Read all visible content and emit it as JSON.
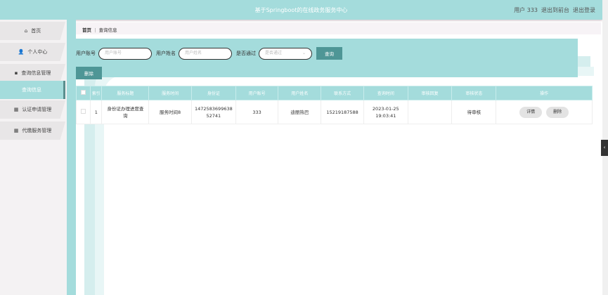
{
  "header": {
    "title": "基于Springboot的在线政务服务中心",
    "user": "用户 333",
    "front": "退出到前台",
    "logout": "退出登录"
  },
  "sidebar": {
    "items": [
      {
        "label": "首页"
      },
      {
        "label": "个人中心"
      },
      {
        "label": "查询信息管理"
      },
      {
        "label": "查询信息"
      },
      {
        "label": "认证申请管理"
      },
      {
        "label": "代缴服务管理"
      }
    ]
  },
  "breadcrumb": {
    "home": "首页",
    "sep": "⋮",
    "current": "查询信息"
  },
  "search": {
    "account_label": "用户账号",
    "account_placeholder": "用户账号",
    "name_label": "用户姓名",
    "name_placeholder": "用户姓名",
    "pass_label": "是否通过",
    "pass_placeholder": "是否通过",
    "query": "查询",
    "delete": "删除"
  },
  "table": {
    "headers": [
      "索引",
      "服务标题",
      "服务时间",
      "身份证",
      "用户账号",
      "用户姓名",
      "联系方式",
      "查询时间",
      "审核回复",
      "审核状态",
      "操作"
    ],
    "rows": [
      {
        "index": "1",
        "title": "身份证办理进度查询",
        "time": "服务时间8",
        "id": "147258369963852741",
        "account": "333",
        "name": "迪丽热巴",
        "phone": "15219187588",
        "query_time": "2023-01-25 19:03:41",
        "reply": "",
        "status": "待审核",
        "detail": "详情",
        "delete": "删除"
      }
    ]
  }
}
